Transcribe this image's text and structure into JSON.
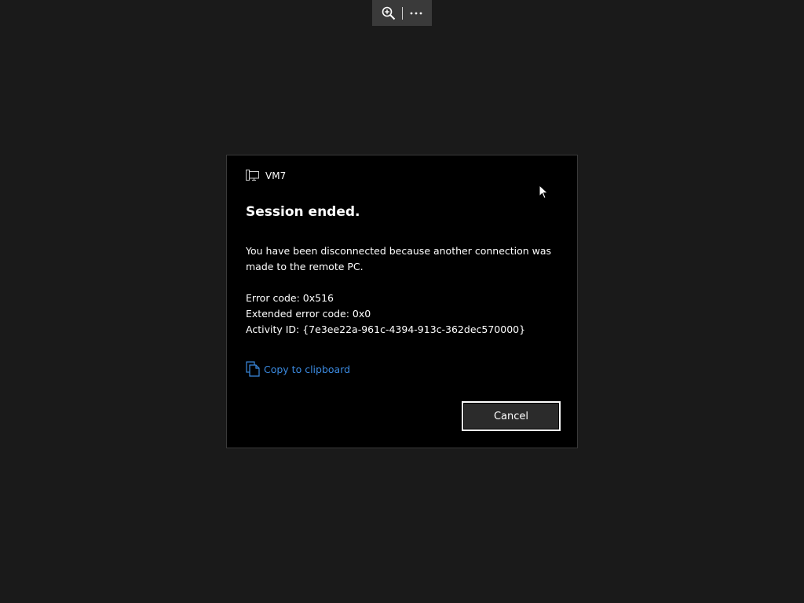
{
  "toolbar": {
    "zoom_icon": "zoom-in-icon",
    "more_icon": "more-horizontal-icon"
  },
  "dialog": {
    "vm_icon": "remote-pc-icon",
    "vm_name": "VM7",
    "title": "Session ended.",
    "message": "You have been disconnected because another connection was made to the remote PC.",
    "error_code": "Error code: 0x516",
    "extended_error_code": "Extended error code: 0x0",
    "activity_id": "Activity ID: {7e3ee22a-961c-4394-913c-362dec570000}",
    "copy_label": "Copy to clipboard",
    "copy_icon": "copy-icon",
    "cancel_label": "Cancel"
  },
  "colors": {
    "background": "#1a1a1a",
    "dialog_bg": "#000000",
    "toolbar_bg": "#3a3a3a",
    "link": "#3b8ae0",
    "button_bg": "#2b2b2b",
    "text": "#ffffff"
  }
}
